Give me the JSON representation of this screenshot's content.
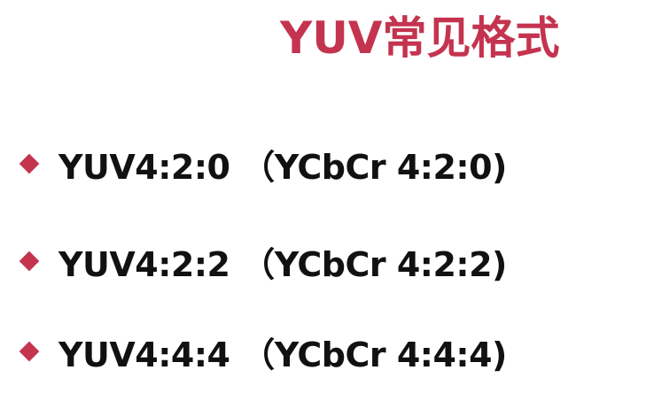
{
  "slide": {
    "title": "YUV常见格式",
    "title_color": "#c4344f",
    "bullet_color": "#c4344f",
    "bullet_icon": "diamond-bullet-icon",
    "bullets": [
      {
        "label": "YUV4:2:0 （YCbCr 4:2:0)"
      },
      {
        "label": "YUV4:2:2 （YCbCr 4:2:2)"
      },
      {
        "label": "YUV4:4:4 （YCbCr 4:4:4)"
      }
    ]
  }
}
